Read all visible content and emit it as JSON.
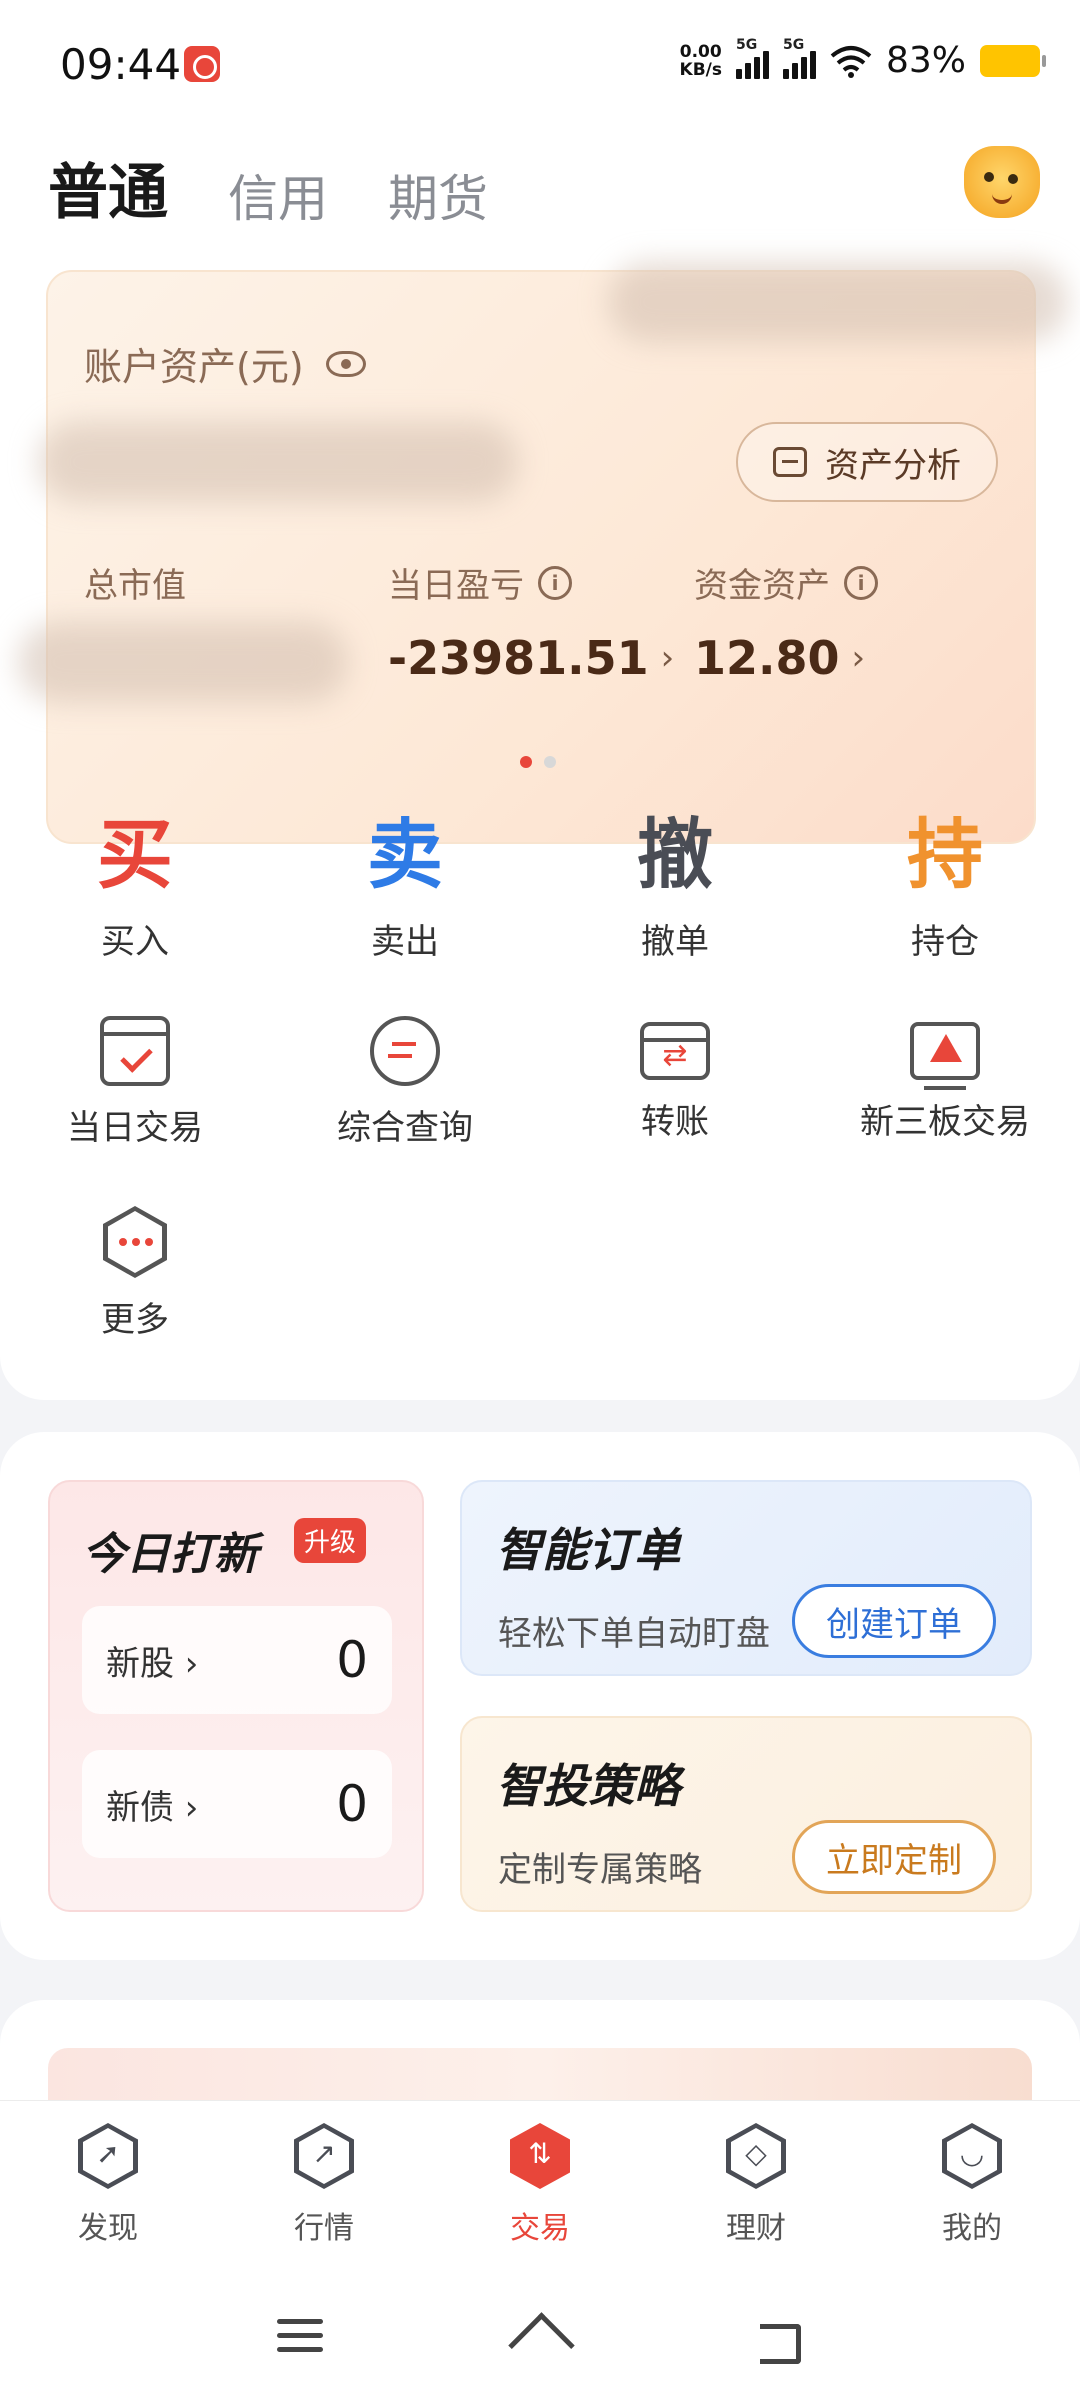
{
  "status_bar": {
    "time": "09:44",
    "net_speed_value": "0.00",
    "net_speed_unit": "KB/s",
    "signal_label_1": "5G",
    "signal_label_2": "5G",
    "battery": "83%"
  },
  "header": {
    "tabs": [
      {
        "label": "普通",
        "active": true
      },
      {
        "label": "信用",
        "active": false
      },
      {
        "label": "期货",
        "active": false
      }
    ],
    "mascot_icon": "mascot-avatar-icon"
  },
  "asset_card": {
    "title": "账户资产(元)",
    "analysis_button": "资产分析",
    "total_market_value_label": "总市值",
    "daily_pnl_label": "当日盈亏",
    "daily_pnl_value": "-23981.51",
    "cash_assets_label": "资金资产",
    "cash_assets_value": "12.80",
    "page_indicator": {
      "count": 2,
      "active": 0
    }
  },
  "actions": [
    {
      "glyph": "买",
      "label": "买入",
      "color": "#e8463a"
    },
    {
      "glyph": "卖",
      "label": "卖出",
      "color": "#2e7be6"
    },
    {
      "glyph": "撤",
      "label": "撤单",
      "color": "#4a4d55"
    },
    {
      "glyph": "持",
      "label": "持仓",
      "color": "#f0922e"
    }
  ],
  "tools": [
    {
      "label": "当日交易",
      "icon": "calendar-check-icon"
    },
    {
      "label": "综合查询",
      "icon": "query-icon"
    },
    {
      "label": "转账",
      "icon": "transfer-icon"
    },
    {
      "label": "新三板交易",
      "icon": "screen-chart-icon"
    },
    {
      "label": "更多",
      "icon": "more-icon"
    }
  ],
  "ipo_card": {
    "title": "今日打新",
    "badge": "升级",
    "rows": [
      {
        "label": "新股",
        "value": "0"
      },
      {
        "label": "新债",
        "value": "0"
      }
    ]
  },
  "smart_order": {
    "title": "智能订单",
    "subtitle": "轻松下单自动盯盘",
    "button": "创建订单"
  },
  "smart_strategy": {
    "title": "智投策略",
    "subtitle": "定制专属策略",
    "button": "立即定制"
  },
  "bottom_nav": [
    {
      "label": "发现",
      "icon": "compass-icon",
      "glyph": "➚",
      "active": false
    },
    {
      "label": "行情",
      "icon": "trend-icon",
      "glyph": "↗",
      "active": false
    },
    {
      "label": "交易",
      "icon": "trade-icon",
      "glyph": "⇅",
      "active": true
    },
    {
      "label": "理财",
      "icon": "diamond-icon",
      "glyph": "◇",
      "active": false
    },
    {
      "label": "我的",
      "icon": "profile-icon",
      "glyph": "◡",
      "active": false
    }
  ],
  "colors": {
    "brand_red": "#e8463a",
    "sell_blue": "#2e7be6",
    "hold_orange": "#f0922e"
  }
}
